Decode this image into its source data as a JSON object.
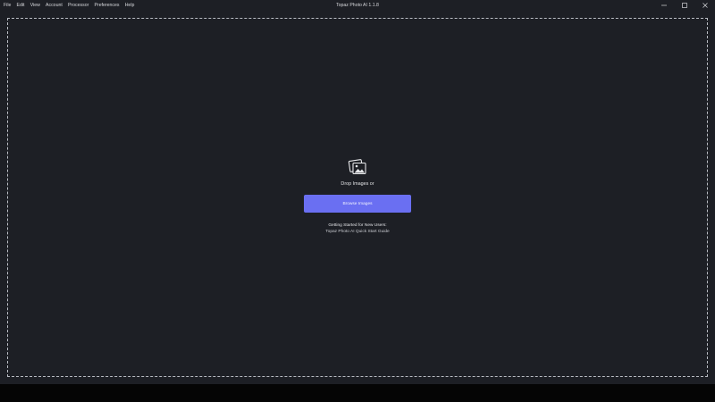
{
  "window": {
    "title": "Topaz Photo AI 1.1.8",
    "controls": [
      "minimize-icon",
      "maximize-icon",
      "close-icon"
    ]
  },
  "menu": {
    "items": [
      "File",
      "Edit",
      "View",
      "Account",
      "Processor",
      "Preferences",
      "Help"
    ]
  },
  "drop_zone": {
    "icon": "images-icon",
    "text": "Drop Images or",
    "browse_label": "Browse Images",
    "getting_started": "Getting Started for New Users:",
    "guide_link": "Topaz Photo AI Quick Start Guide"
  },
  "colors": {
    "background": "#1d1f25",
    "accent": "#6a6ff2",
    "bottom_bar": "#050505"
  }
}
